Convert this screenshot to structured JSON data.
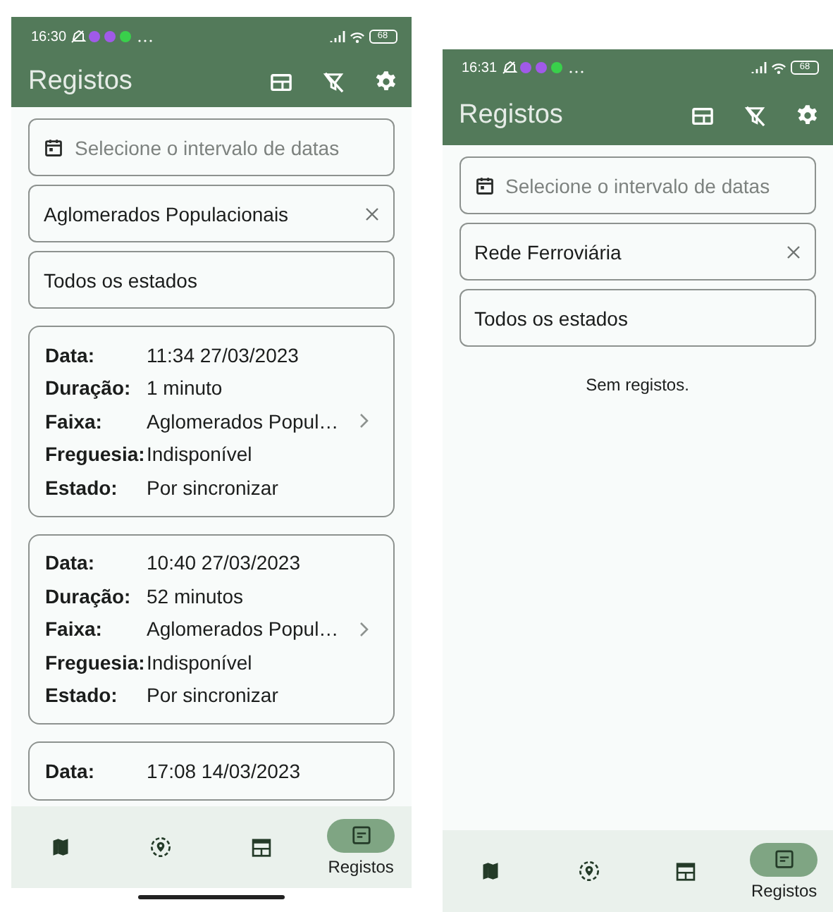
{
  "screens": [
    {
      "status_bar": {
        "time": "16:30",
        "battery": "68"
      },
      "app_bar": {
        "title": "Registos"
      },
      "filters": {
        "date_range": {
          "placeholder": "Selecione o intervalo de datas"
        },
        "category": {
          "value": "Aglomerados Populacionais"
        },
        "state": {
          "value": "Todos os estados"
        }
      },
      "records": [
        {
          "fields": [
            {
              "label": "Data:",
              "value": "11:34 27/03/2023",
              "kind": "plain"
            },
            {
              "label": "Duração:",
              "value": "1 minuto",
              "kind": "plain"
            },
            {
              "label": "Faixa:",
              "value": "Aglomerados Popul…",
              "kind": "link"
            },
            {
              "label": "Freguesia:",
              "value": "Indisponível",
              "kind": "plain"
            },
            {
              "label": "Estado:",
              "value": "Por sincronizar",
              "kind": "plain"
            }
          ]
        },
        {
          "fields": [
            {
              "label": "Data:",
              "value": "10:40 27/03/2023",
              "kind": "plain"
            },
            {
              "label": "Duração:",
              "value": "52 minutos",
              "kind": "plain"
            },
            {
              "label": "Faixa:",
              "value": "Aglomerados Popul…",
              "kind": "link"
            },
            {
              "label": "Freguesia:",
              "value": "Indisponível",
              "kind": "plain"
            },
            {
              "label": "Estado:",
              "value": "Por sincronizar",
              "kind": "plain"
            }
          ]
        },
        {
          "fields": [
            {
              "label": "Data:",
              "value": "17:08 14/03/2023",
              "kind": "plain"
            }
          ]
        }
      ],
      "nav": [
        {
          "kind": "map",
          "selected": false
        },
        {
          "kind": "location",
          "selected": false
        },
        {
          "kind": "calendar",
          "selected": false
        },
        {
          "kind": "records",
          "label": "Registos",
          "selected": true
        }
      ]
    },
    {
      "status_bar": {
        "time": "16:31",
        "battery": "68"
      },
      "app_bar": {
        "title": "Registos"
      },
      "filters": {
        "date_range": {
          "placeholder": "Selecione o intervalo de datas"
        },
        "category": {
          "value": "Rede Ferroviária"
        },
        "state": {
          "value": "Todos os estados"
        }
      },
      "empty_message": "Sem registos.",
      "nav": [
        {
          "kind": "map",
          "selected": false
        },
        {
          "kind": "location",
          "selected": false
        },
        {
          "kind": "calendar",
          "selected": false
        },
        {
          "kind": "records",
          "label": "Registos",
          "selected": true
        }
      ]
    }
  ]
}
